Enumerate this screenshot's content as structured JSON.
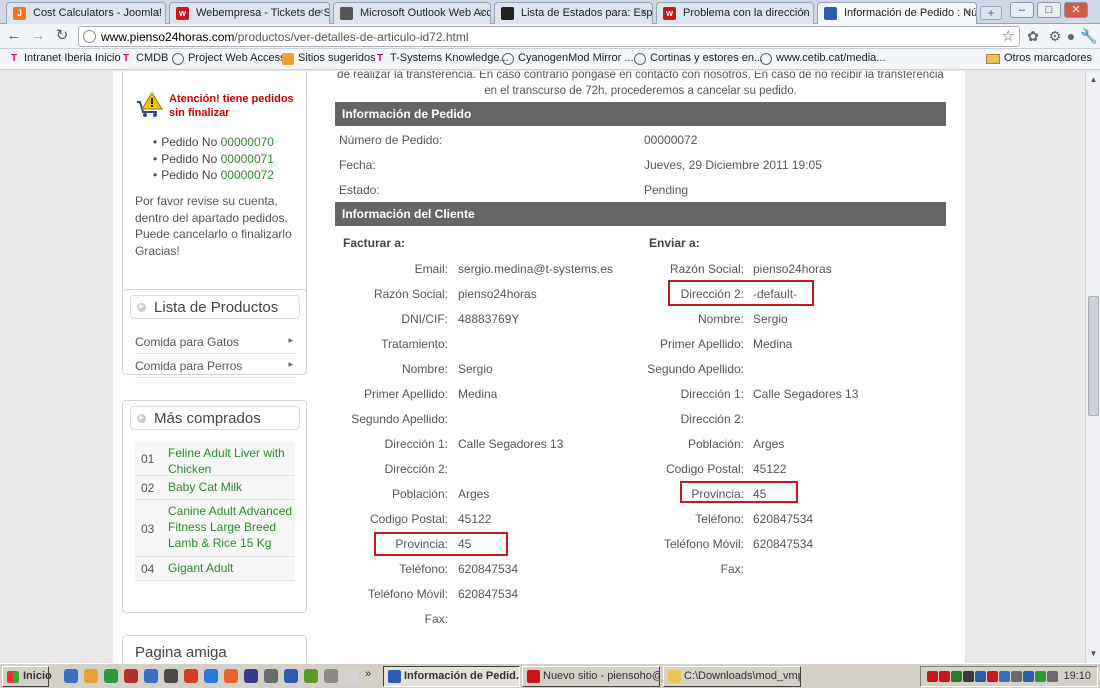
{
  "browser": {
    "tabs": [
      {
        "label": "Cost Calculators - Joomla! Ex",
        "icon": "joomla-icon",
        "color": "#e87722"
      },
      {
        "label": "Webempresa - Tickets de Sop",
        "icon": "webempresa-icon",
        "color": "#c8161d"
      },
      {
        "label": "Microsoft Outlook Web Acces",
        "icon": "outlook-icon",
        "color": "#555555"
      },
      {
        "label": "Lista de Estados para: Españ",
        "icon": "virtuemart-icon",
        "color": "#222222"
      },
      {
        "label": "Problema con la dirección de",
        "icon": "webempresa-icon",
        "color": "#c8161d"
      },
      {
        "label": "Información de Pedido : Núm",
        "icon": "globe-icon",
        "color": "#2a5db0"
      }
    ],
    "url_domain": "www.pienso24horas.com",
    "url_path": "/productos/ver-detalles-de-articulo-id72.html",
    "bookmarks": [
      {
        "label": "Intranet Iberia Inicio",
        "icon": "t-logo-icon"
      },
      {
        "label": "CMDB",
        "icon": "t-logo-icon"
      },
      {
        "label": "Project Web Access",
        "icon": "globe-icon"
      },
      {
        "label": "Sitios sugeridos",
        "icon": "suggest-icon"
      },
      {
        "label": "T-Systems Knowledge...",
        "icon": "t-logo-icon"
      },
      {
        "label": "CyanogenMod Mirror ...",
        "icon": "globe-icon"
      },
      {
        "label": "Cortinas y estores en...",
        "icon": "globe-icon"
      },
      {
        "label": "www.cetib.cat/media...",
        "icon": "globe-icon"
      }
    ],
    "other_bookmarks": "Otros marcadores"
  },
  "sidebar": {
    "notice": {
      "title_line1": "Atención! tiene pedidos",
      "title_line2": "sin finalizar",
      "order_prefix": "Pedido No",
      "orders": [
        "00000070",
        "00000071",
        "00000072"
      ],
      "text": "Por favor revise su cuenta, dentro del apartado pedidos. Puede cancelarlo o finalizarlo Gracias!"
    },
    "products": {
      "title": "Lista de Productos",
      "items": [
        "Comida para Gatos",
        "Comida para Perros"
      ]
    },
    "top_sellers": {
      "title": "Más comprados",
      "items": [
        {
          "num": "01",
          "name": "Feline Adult Liver with Chicken"
        },
        {
          "num": "02",
          "name": "Baby Cat Milk"
        },
        {
          "num": "03",
          "name": "Canine Adult Advanced Fitness Large Breed Lamb & Rice 15 Kg"
        },
        {
          "num": "04",
          "name": "Gigant Adult"
        }
      ]
    },
    "friend": {
      "title": "Pagina amiga"
    }
  },
  "main": {
    "intro_line1": "de realizar la transferencia. En caso contrario póngase en contacto con nosotros. En caso de no recibir la transferencia",
    "intro_line2": "en el transcurso de 72h, procederemos a cancelar su pedido.",
    "order_section": "Información de Pedido",
    "order_rows": [
      {
        "label": "Número de Pedido:",
        "value": "00000072"
      },
      {
        "label": "Fecha:",
        "value": "Jueves, 29 Diciembre 2011 19:05"
      },
      {
        "label": "Estado:",
        "value": "Pending"
      }
    ],
    "client_section": "Información del Cliente",
    "billing": {
      "title": "Facturar a:",
      "rows": [
        {
          "label": "Email:",
          "value": "sergio.medina@t-systems.es"
        },
        {
          "label": "Razón Social:",
          "value": "pienso24horas"
        },
        {
          "label": "DNI/CIF:",
          "value": "48883769Y"
        },
        {
          "label": "Tratamiento:",
          "value": ""
        },
        {
          "label": "Nombre:",
          "value": "Sergio"
        },
        {
          "label": "Primer Apellido:",
          "value": "Medina"
        },
        {
          "label": "Segundo Apellido:",
          "value": ""
        },
        {
          "label": "Dirección 1:",
          "value": "Calle Segadores 13"
        },
        {
          "label": "Dirección 2:",
          "value": ""
        },
        {
          "label": "Población:",
          "value": "Arges"
        },
        {
          "label": "Codigo Postal:",
          "value": "45122"
        },
        {
          "label": "Provincia:",
          "value": "45"
        },
        {
          "label": "Teléfono:",
          "value": "620847534"
        },
        {
          "label": "Teléfono Móvil:",
          "value": "620847534"
        },
        {
          "label": "Fax:",
          "value": ""
        }
      ]
    },
    "shipping": {
      "title": "Enviar a:",
      "rows": [
        {
          "label": "Razón Social:",
          "value": "pienso24horas"
        },
        {
          "label": "Dirección 2:",
          "value": "-default-"
        },
        {
          "label": "Nombre:",
          "value": "Sergio"
        },
        {
          "label": "Primer Apellido:",
          "value": "Medina"
        },
        {
          "label": "Segundo Apellido:",
          "value": ""
        },
        {
          "label": "Dirección 1:",
          "value": "Calle Segadores 13"
        },
        {
          "label": "Dirección 2:",
          "value": ""
        },
        {
          "label": "Población:",
          "value": "Arges"
        },
        {
          "label": "Codigo Postal:",
          "value": "45122"
        },
        {
          "label": "Provincia:",
          "value": "45"
        },
        {
          "label": "Teléfono:",
          "value": "620847534"
        },
        {
          "label": "Teléfono Móvil:",
          "value": "620847534"
        },
        {
          "label": "Fax:",
          "value": ""
        }
      ]
    },
    "highlight_color": "#c8161d"
  },
  "taskbar": {
    "start_label": "Inicio",
    "overflow": "»",
    "tasks": [
      {
        "label": "Información de Pedid...",
        "icon": "chrome-icon",
        "active": true
      },
      {
        "label": "Nuevo sitio - piensoho@...",
        "icon": "filezilla-icon",
        "active": false
      },
      {
        "label": "C:\\Downloads\\mod_vmp...",
        "icon": "folder-icon",
        "active": false
      }
    ],
    "clock": "19:10"
  }
}
